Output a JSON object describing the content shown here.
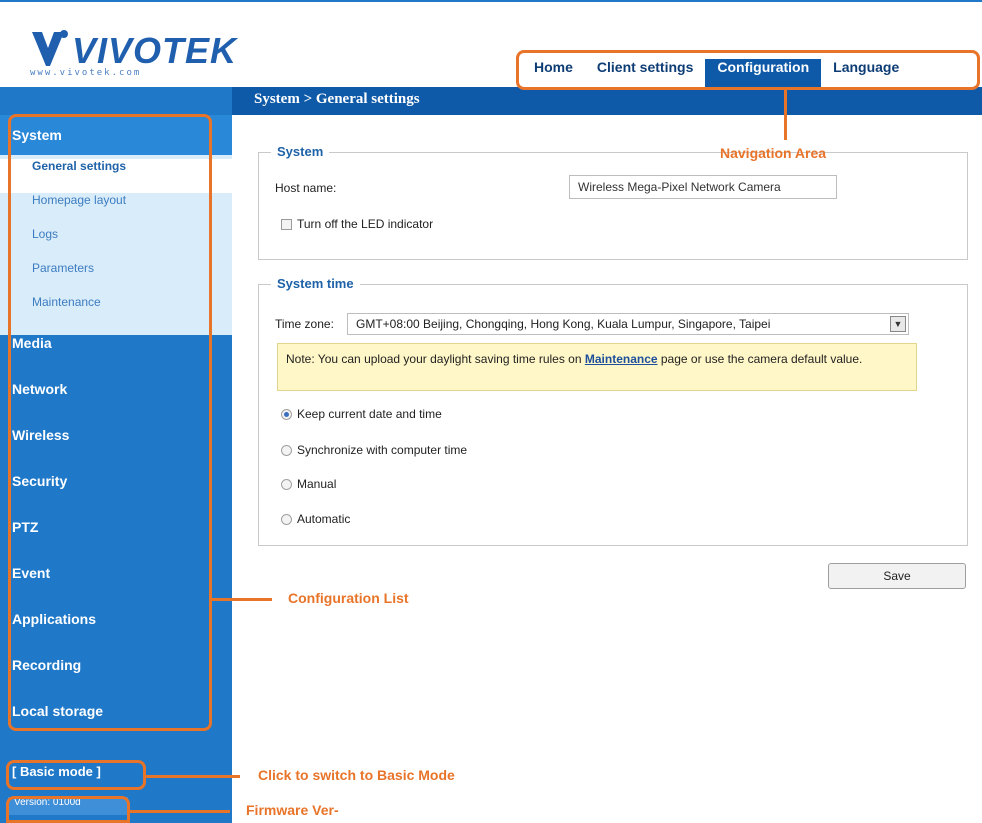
{
  "brand": {
    "logo_text": "VIVOTEK",
    "logo_url": "www.vivotek.com"
  },
  "nav": {
    "items": [
      {
        "label": "Home"
      },
      {
        "label": "Client settings"
      },
      {
        "label": "Configuration",
        "active": true
      },
      {
        "label": "Language"
      }
    ]
  },
  "page": {
    "title": "System > General settings"
  },
  "sidebar": {
    "items": [
      {
        "label": "System"
      },
      {
        "label": "Media"
      },
      {
        "label": "Network"
      },
      {
        "label": "Wireless"
      },
      {
        "label": "Security"
      },
      {
        "label": "PTZ"
      },
      {
        "label": "Event"
      },
      {
        "label": "Applications"
      },
      {
        "label": "Recording"
      },
      {
        "label": "Local storage"
      }
    ],
    "sub_items": [
      {
        "label": "General settings",
        "active": true
      },
      {
        "label": "Homepage layout"
      },
      {
        "label": "Logs"
      },
      {
        "label": "Parameters"
      },
      {
        "label": "Maintenance"
      }
    ],
    "basic_mode": "[ Basic mode ]",
    "version": "Version: 0100d"
  },
  "system_section": {
    "legend": "System",
    "host_label": "Host name:",
    "host_value": "Wireless Mega-Pixel Network Camera",
    "led_label": "Turn off the LED indicator",
    "led_checked": false
  },
  "time_section": {
    "legend": "System time",
    "tz_label": "Time zone:",
    "tz_value": "GMT+08:00 Beijing, Chongqing, Hong Kong, Kuala Lumpur, Singapore, Taipei",
    "note_prefix": "Note: You can upload your daylight saving time rules on ",
    "note_link": "Maintenance",
    "note_suffix": " page or use the camera default value.",
    "options": [
      {
        "label": "Keep current date and time",
        "selected": true
      },
      {
        "label": "Synchronize with computer time",
        "selected": false
      },
      {
        "label": "Manual",
        "selected": false
      },
      {
        "label": "Automatic",
        "selected": false
      }
    ]
  },
  "save_label": "Save",
  "annotations": {
    "navigation_area": "Navigation Area",
    "configuration_list": "Configuration List",
    "basic_mode_hint": "Click to switch to Basic Mode",
    "firmware": "Firmware Ver-"
  },
  "colors": {
    "sidebar_blue": "#1f78c8",
    "header_blue": "#0e5aa8",
    "annotation_orange": "#e8742a"
  }
}
